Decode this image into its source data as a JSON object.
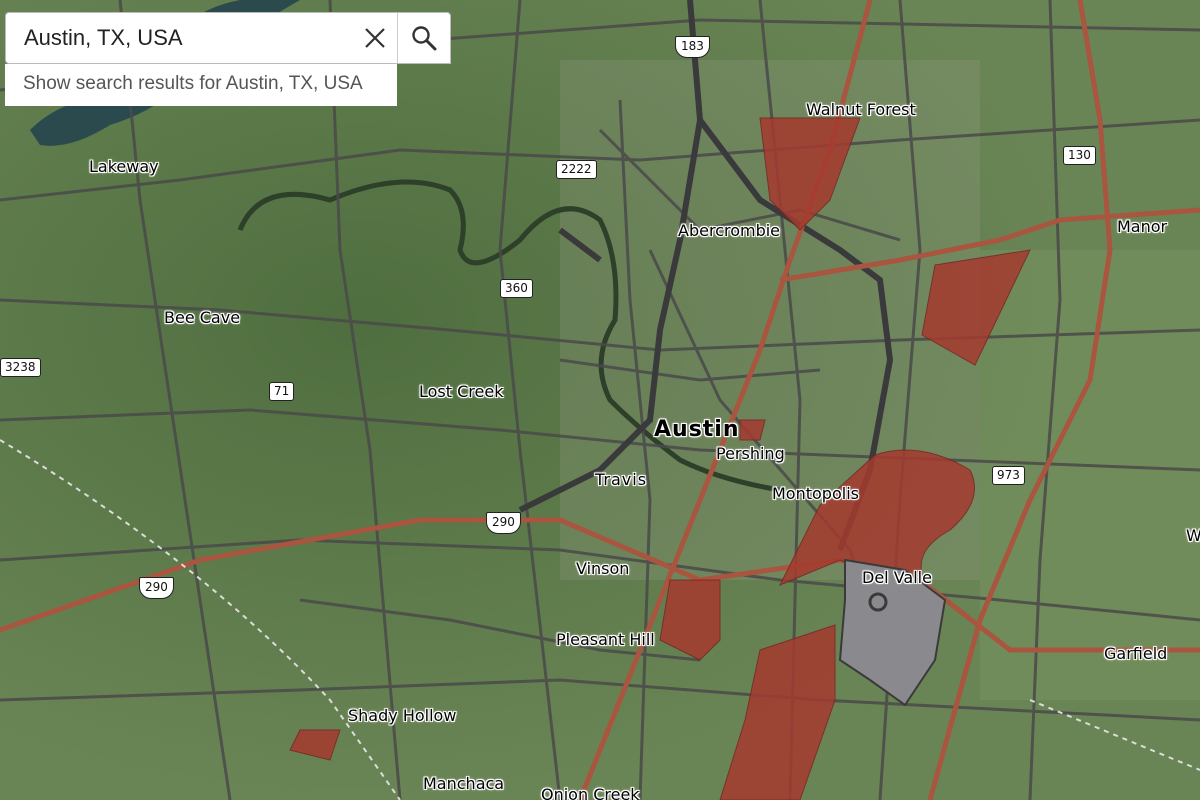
{
  "search": {
    "value": "Austin, TX, USA",
    "suggestion": "Show search results for Austin, TX, USA",
    "clear_icon": "close-icon",
    "search_icon": "search-icon"
  },
  "map": {
    "colors": {
      "land": "#5f7a4c",
      "road": "#4a4a4a",
      "highway": "#a9553f",
      "shaded_area": "#a53a2f",
      "airport_area": "#8a8a8e",
      "water": "#2a4a4e"
    },
    "places": {
      "lakeway": "Lakeway",
      "bee_cave": "Bee Cave",
      "lost_creek": "Lost Creek",
      "walnut_forest": "Walnut Forest",
      "abercrombie": "Abercrombie",
      "manor": "Manor",
      "austin": "Austin",
      "pershing": "Pershing",
      "travis": "Travis",
      "montopolis": "Montopolis",
      "vinson": "Vinson",
      "del_valle": "Del Valle",
      "pleasant_hill": "Pleasant Hill",
      "garfield": "Garfield",
      "shady_hollow": "Shady Hollow",
      "manchaca": "Manchaca",
      "onion_creek": "Onion Creek",
      "partial_w": "W"
    },
    "shields": {
      "r183": "183",
      "r2222": "2222",
      "r130": "130",
      "r360": "360",
      "r3238": "3238",
      "r71": "71",
      "r290a": "290",
      "r290b": "290",
      "r973": "973"
    }
  }
}
